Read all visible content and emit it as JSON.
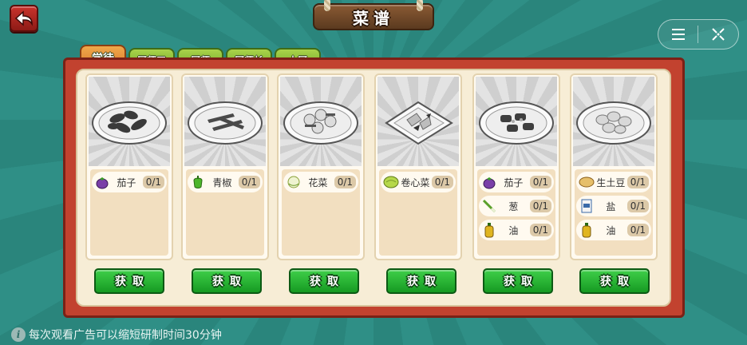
{
  "header": {
    "title": "菜谱"
  },
  "tabs": [
    {
      "label": "学徒",
      "active": true
    },
    {
      "label": "厨师工",
      "active": false
    },
    {
      "label": "厨师",
      "active": false
    },
    {
      "label": "厨师长",
      "active": false
    },
    {
      "label": "大厨",
      "active": false
    }
  ],
  "dishes": [
    {
      "plate": "round",
      "ingredients": [
        {
          "icon": "eggplant-icon",
          "name": "茄子",
          "count": "0/1"
        }
      ],
      "button": "获取"
    },
    {
      "plate": "round",
      "ingredients": [
        {
          "icon": "green-pepper-icon",
          "name": "青椒",
          "count": "0/1"
        }
      ],
      "button": "获取"
    },
    {
      "plate": "round",
      "ingredients": [
        {
          "icon": "cauliflower-icon",
          "name": "花菜",
          "count": "0/1"
        }
      ],
      "button": "获取"
    },
    {
      "plate": "square",
      "ingredients": [
        {
          "icon": "cabbage-icon",
          "name": "卷心菜",
          "count": "0/1"
        }
      ],
      "button": "获取"
    },
    {
      "plate": "round",
      "ingredients": [
        {
          "icon": "eggplant-icon",
          "name": "茄子",
          "count": "0/1"
        },
        {
          "icon": "scallion-icon",
          "name": "葱",
          "count": "0/1"
        },
        {
          "icon": "oil-bottle-icon",
          "name": "油",
          "count": "0/1"
        }
      ],
      "button": "获取"
    },
    {
      "plate": "round",
      "ingredients": [
        {
          "icon": "potato-icon",
          "name": "生土豆",
          "count": "0/1"
        },
        {
          "icon": "salt-icon",
          "name": "盐",
          "count": "0/1"
        },
        {
          "icon": "oil-bottle-icon",
          "name": "油",
          "count": "0/1"
        }
      ],
      "button": "获取"
    }
  ],
  "footer": {
    "tip": "每次观看广告可以缩短研制时间30分钟",
    "tip_icon": "info-icon"
  },
  "colors": {
    "frame": "#c2422f",
    "tab_active": "#e08a32",
    "tab_inactive": "#8cc23a",
    "button": "#22b12e",
    "background": "#2d8a81"
  }
}
